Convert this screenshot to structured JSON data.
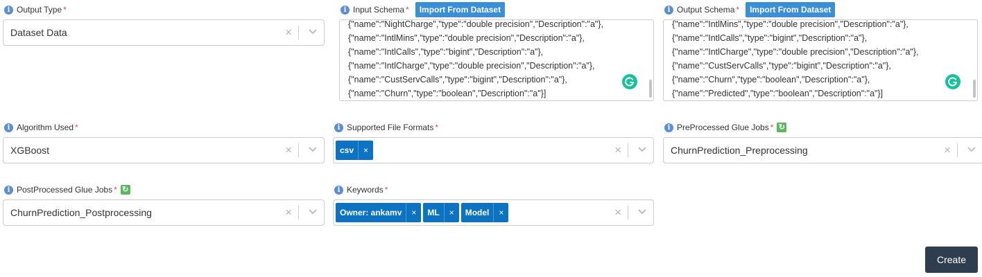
{
  "output_type": {
    "label": "Output Type",
    "required_mark": "*",
    "value": "Dataset Data"
  },
  "input_schema": {
    "label": "Input Schema",
    "required_mark": "*",
    "import_label": "Import From Dataset",
    "lines": [
      "{\"name\":\"NightCharge\",\"type\":\"double precision\",\"Description\":\"a\"},",
      "{\"name\":\"IntlMins\",\"type\":\"double precision\",\"Description\":\"a\"},",
      "{\"name\":\"IntlCalls\",\"type\":\"bigint\",\"Description\":\"a\"},",
      "{\"name\":\"IntlCharge\",\"type\":\"double precision\",\"Description\":\"a\"},",
      "{\"name\":\"CustServCalls\",\"type\":\"bigint\",\"Description\":\"a\"},",
      "{\"name\":\"Churn\",\"type\":\"boolean\",\"Description\":\"a\"}]"
    ]
  },
  "output_schema": {
    "label": "Output Schema",
    "required_mark": "*",
    "import_label": "Import From Dataset",
    "lines": [
      "{\"name\":\"IntlMins\",\"type\":\"double precision\",\"Description\":\"a\"},",
      "{\"name\":\"IntlCalls\",\"type\":\"bigint\",\"Description\":\"a\"},",
      "{\"name\":\"IntlCharge\",\"type\":\"double precision\",\"Description\":\"a\"},",
      "{\"name\":\"CustServCalls\",\"type\":\"bigint\",\"Description\":\"a\"},",
      "{\"name\":\"Churn\",\"type\":\"boolean\",\"Description\":\"a\"},",
      "{\"name\":\"Predicted\",\"type\":\"boolean\",\"Description\":\"a\"}]"
    ]
  },
  "algorithm": {
    "label": "Algorithm Used",
    "required_mark": "*",
    "value": "XGBoost"
  },
  "file_formats": {
    "label": "Supported File Formats",
    "required_mark": "*",
    "chips": [
      "csv"
    ]
  },
  "preprocessed": {
    "label": "PreProcessed Glue Jobs",
    "required_mark": "*",
    "value": "ChurnPrediction_Preprocessing"
  },
  "postprocessed": {
    "label": "PostProcessed Glue Jobs",
    "required_mark": "*",
    "value": "ChurnPrediction_Postprocessing"
  },
  "keywords": {
    "label": "Keywords",
    "required_mark": "*",
    "chips": [
      "Owner: ankamv",
      "ML",
      "Model"
    ]
  },
  "glyphs": {
    "info": "i",
    "clear": "×",
    "chip_remove": "×",
    "refresh": "↻"
  },
  "icons": {
    "info": "info-icon",
    "refresh": "refresh-icon",
    "clear": "clear-icon",
    "dropdown": "chevron-down-icon",
    "grammarly": "grammarly-icon"
  },
  "colors": {
    "info_icon": "#5b8fd4",
    "required": "#d9534f",
    "import_button": "#3a8fd6",
    "chip": "#0c73c2",
    "refresh_icon": "#5cb85c",
    "grammarly": "#15c39a",
    "create_button": "#2f3e4e"
  },
  "create_label": "Create"
}
